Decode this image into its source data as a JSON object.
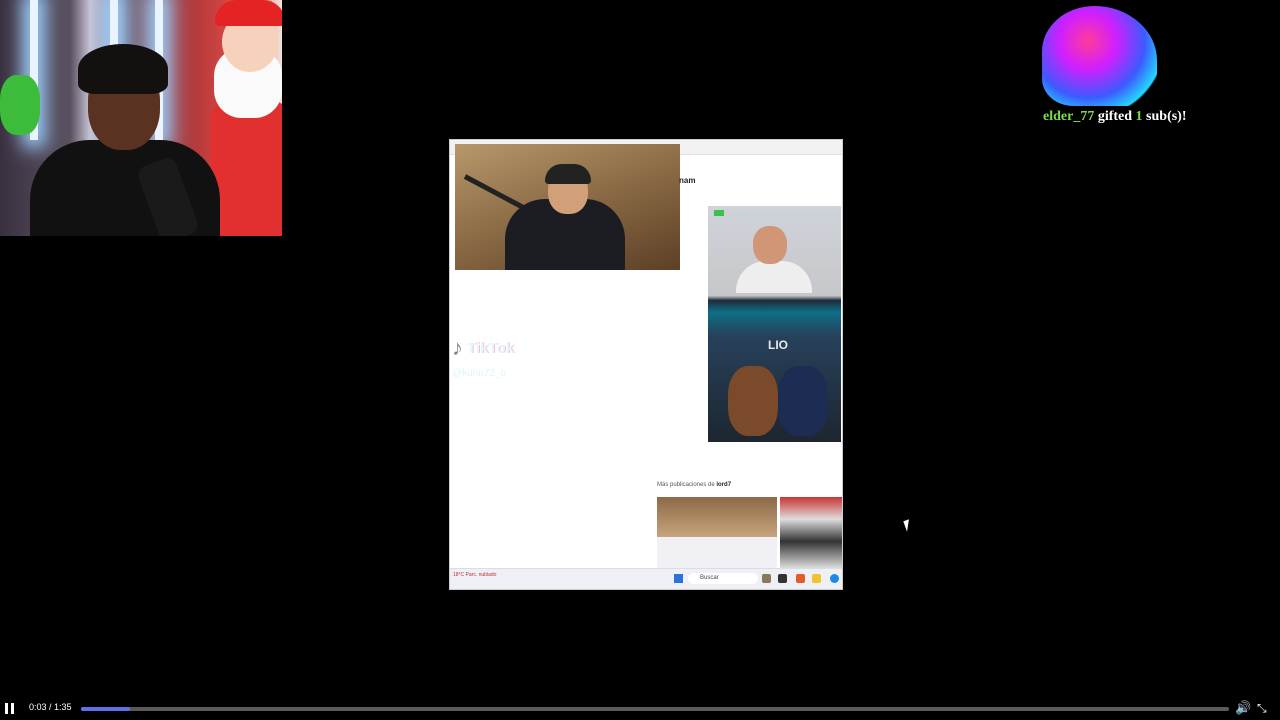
{
  "alert": {
    "username": "elder_77",
    "action": " gifted ",
    "count": "1",
    "suffix": " sub(s)!"
  },
  "shared_screen": {
    "page_heading": "nam",
    "tiktok_word": "TikTok",
    "tiktok_handle": "@kunn72_o",
    "side_video_label": "LIO",
    "more_posts_prefix": "Más publicaciones de ",
    "more_posts_user": "lord7",
    "taskbar_search": "Buscar",
    "taskbar_status": "18°C Parc. nublado"
  },
  "player": {
    "time_current": "0:03",
    "time_separator": " / ",
    "time_total": "1:35",
    "progress_fraction": 0.043,
    "state": "playing"
  },
  "icons": {
    "pause": "pause-icon",
    "volume": "volume-icon",
    "fullscreen": "exit-fullscreen-icon",
    "cursor": "mouse-cursor-icon"
  }
}
